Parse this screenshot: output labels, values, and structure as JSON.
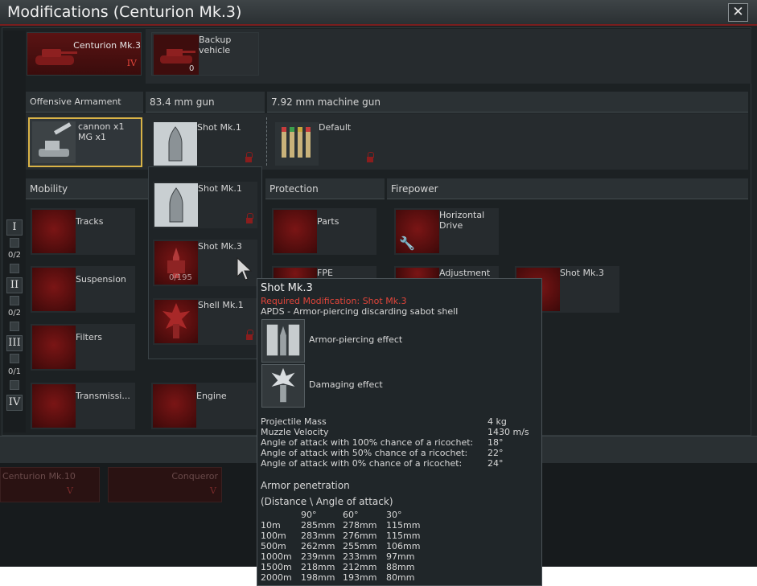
{
  "window": {
    "title": "Modifications (Centurion Mk.3)",
    "close_glyph": "✕"
  },
  "vehicles": {
    "current": {
      "name": "Centurion Mk.3",
      "rank": "IV"
    },
    "backup": {
      "name": "Backup vehicle",
      "count": "0"
    }
  },
  "armament": {
    "header": "Offensive Armament",
    "weapon": "cannon x1\nMG x1",
    "gun_header": "83.4 mm gun",
    "mg_header": "7.92 mm machine gun",
    "gun_slot": "Shot Mk.1",
    "mg_slot": "Default"
  },
  "sections": {
    "mobility": "Mobility",
    "protection": "Protection",
    "firepower": "Firepower"
  },
  "mobility_items": [
    "Tracks",
    "Suspension",
    "Filters",
    "Transmissi...",
    "Engine"
  ],
  "protection_items": [
    "Parts",
    "FPE"
  ],
  "firepower_items": [
    "Horizontal Drive",
    "Adjustment",
    "Shot Mk.3"
  ],
  "tiers": [
    {
      "label": "I",
      "count": "0/2"
    },
    {
      "label": "II",
      "count": "0/2"
    },
    {
      "label": "III",
      "count": "0/1"
    },
    {
      "label": "IV",
      "count": ""
    }
  ],
  "dropdown": {
    "items": [
      {
        "label": "Shot Mk.1",
        "progress": ""
      },
      {
        "label": "Shot Mk.3",
        "progress": "0/195"
      },
      {
        "label": "Shell Mk.1",
        "progress": ""
      }
    ]
  },
  "tooltip": {
    "title": "Shot Mk.3",
    "required": "Required Modification: Shot Mk.3",
    "description": "APDS - Armor-piercing discarding sabot shell",
    "effects": [
      "Armor-piercing effect",
      "Damaging effect"
    ],
    "stats": [
      {
        "label": "Projectile Mass",
        "value": "4 kg"
      },
      {
        "label": "Muzzle Velocity",
        "value": "1430 m/s"
      },
      {
        "label": "Angle of attack with 100% chance of a ricochet:",
        "value": "18°"
      },
      {
        "label": "Angle of attack with 50% chance of a ricochet:",
        "value": "22°"
      },
      {
        "label": "Angle of attack with 0% chance of a ricochet:",
        "value": "24°"
      }
    ],
    "penetration_title": "Armor penetration",
    "penetration_subtitle": "(Distance \\ Angle of attack)",
    "angles": [
      "90°",
      "60°",
      "30°"
    ],
    "rows": [
      {
        "distance": "10m",
        "values": [
          "285mm",
          "278mm",
          "115mm"
        ]
      },
      {
        "distance": "100m",
        "values": [
          "283mm",
          "276mm",
          "115mm"
        ]
      },
      {
        "distance": "500m",
        "values": [
          "262mm",
          "255mm",
          "106mm"
        ]
      },
      {
        "distance": "1000m",
        "values": [
          "239mm",
          "233mm",
          "97mm"
        ]
      },
      {
        "distance": "1500m",
        "values": [
          "218mm",
          "212mm",
          "88mm"
        ]
      },
      {
        "distance": "2000m",
        "values": [
          "198mm",
          "193mm",
          "80mm"
        ]
      }
    ]
  },
  "research": {
    "left": {
      "name": "Centurion Mk.10",
      "rank": "V"
    },
    "right": {
      "name": "Conqueror",
      "rank": "V"
    }
  },
  "colors": {
    "accent_red": "#e2453a",
    "selected_border": "#d9b347"
  }
}
